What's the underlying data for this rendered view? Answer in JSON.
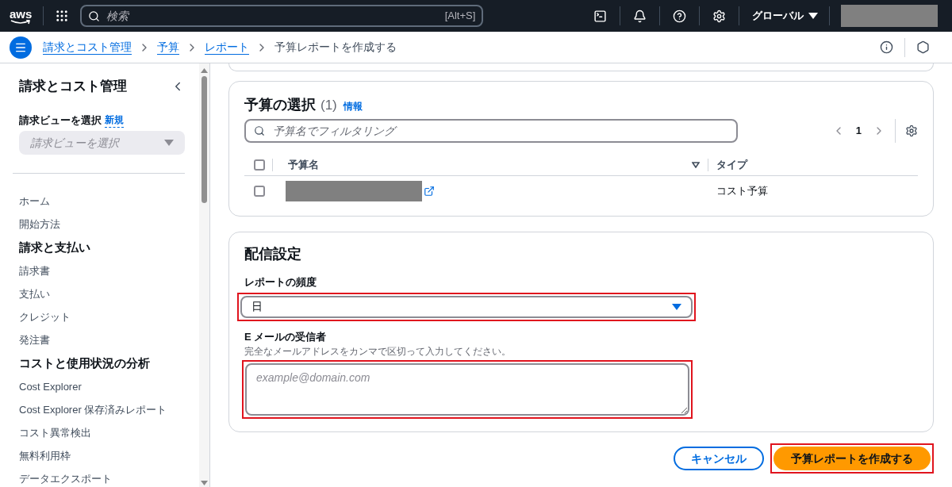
{
  "top_bar": {
    "logo": "aws",
    "search": {
      "placeholder": "検索",
      "shortcut": "[Alt+S]"
    },
    "region": "グローバル"
  },
  "breadcrumbs": [
    {
      "label": "請求とコスト管理",
      "link": true
    },
    {
      "label": "予算",
      "link": true
    },
    {
      "label": "レポート",
      "link": true
    },
    {
      "label": "予算レポートを作成する",
      "link": false
    }
  ],
  "sidebar": {
    "title": "請求とコスト管理",
    "view_label": "請求ビューを選択",
    "view_badge": "新規",
    "view_placeholder": "請求ビューを選択",
    "items": [
      {
        "label": "ホーム",
        "kind": "link"
      },
      {
        "label": "開始方法",
        "kind": "link"
      },
      {
        "label": "請求と支払い",
        "kind": "heading"
      },
      {
        "label": "請求書",
        "kind": "link"
      },
      {
        "label": "支払い",
        "kind": "link"
      },
      {
        "label": "クレジット",
        "kind": "link"
      },
      {
        "label": "発注書",
        "kind": "link"
      },
      {
        "label": "コストと使用状況の分析",
        "kind": "heading"
      },
      {
        "label": "Cost Explorer",
        "kind": "link"
      },
      {
        "label": "Cost Explorer 保存済みレポート",
        "kind": "link"
      },
      {
        "label": "コスト異常検出",
        "kind": "link"
      },
      {
        "label": "無料利用枠",
        "kind": "link"
      },
      {
        "label": "データエクスポート",
        "kind": "link"
      }
    ]
  },
  "budget_selection": {
    "title": "予算の選択",
    "count": "(1)",
    "info": "情報",
    "filter": {
      "placeholder": "予算名でフィルタリング"
    },
    "page": "1",
    "all_checked": false,
    "columns": [
      "予算名",
      "タイプ"
    ],
    "rows": [
      {
        "checked": false,
        "type": "コスト予算"
      }
    ]
  },
  "delivery": {
    "title": "配信設定",
    "frequency": {
      "label": "レポートの頻度",
      "value": "日",
      "highlighted": true
    },
    "recipients": {
      "label": "E メールの受信者",
      "hint": "完全なメールアドレスをカンマで区切って入力してください。",
      "placeholder": "example@domain.com",
      "highlighted": true
    }
  },
  "actions": [
    {
      "label": "キャンセル",
      "kind": "secondary",
      "highlighted": false
    },
    {
      "label": "予算レポートを作成する",
      "kind": "primary",
      "highlighted": true
    }
  ]
}
